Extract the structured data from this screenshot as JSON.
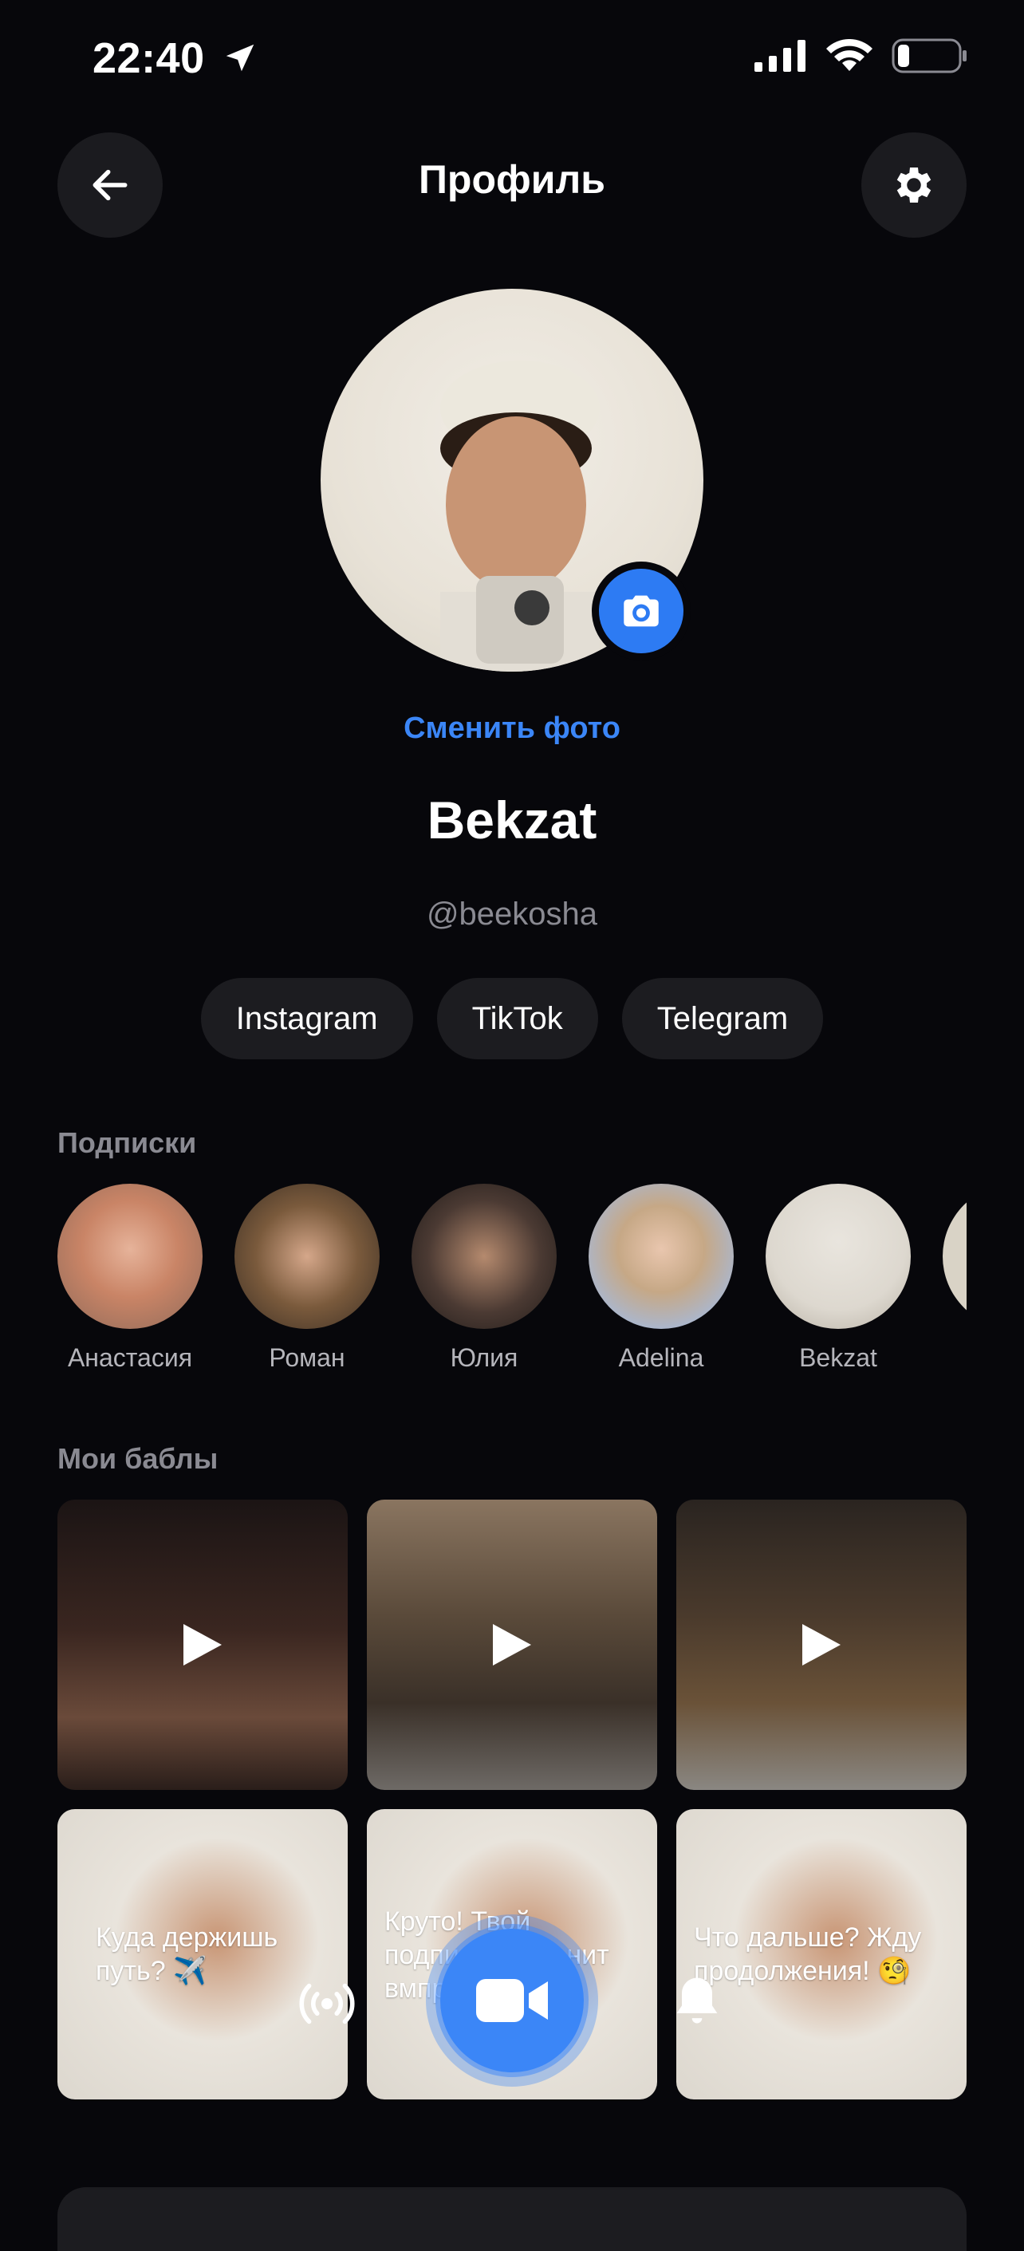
{
  "status": {
    "time": "22:40",
    "icons": [
      "location-arrow-icon",
      "signal-icon",
      "wifi-icon",
      "battery-icon"
    ]
  },
  "header": {
    "title": "Профиль",
    "back_icon": "arrow-left-icon",
    "settings_icon": "gear-icon"
  },
  "profile": {
    "change_photo": "Сменить фото",
    "name": "Bekzat",
    "handle": "@beekosha"
  },
  "links": [
    "Instagram",
    "TikTok",
    "Telegram"
  ],
  "subscriptions": {
    "label": "Подписки",
    "items": [
      {
        "name": "Анастасия",
        "color": "#c98466"
      },
      {
        "name": "Роман",
        "color": "#7a5a3c"
      },
      {
        "name": "Юлия",
        "color": "#4b3a33"
      },
      {
        "name": "Adelina",
        "color": "#a6b9d9"
      },
      {
        "name": "Bekzat",
        "color": "#ddd8cf"
      }
    ]
  },
  "bubbles": {
    "label": "Мои баблы",
    "items": [
      {
        "type": "video",
        "caption": ""
      },
      {
        "type": "video",
        "caption": ""
      },
      {
        "type": "video",
        "caption": ""
      },
      {
        "type": "photo",
        "caption": "Куда держишь путь? ✈️"
      },
      {
        "type": "photo",
        "caption": "Круто! Твой подписчик оценит вмпрёться!"
      },
      {
        "type": "photo",
        "caption": "Что дальше? Жду продолжения! 🧐"
      }
    ]
  },
  "colors": {
    "accent": "#3b86f7",
    "bg": "#07070b",
    "pill": "#1c1c20"
  }
}
